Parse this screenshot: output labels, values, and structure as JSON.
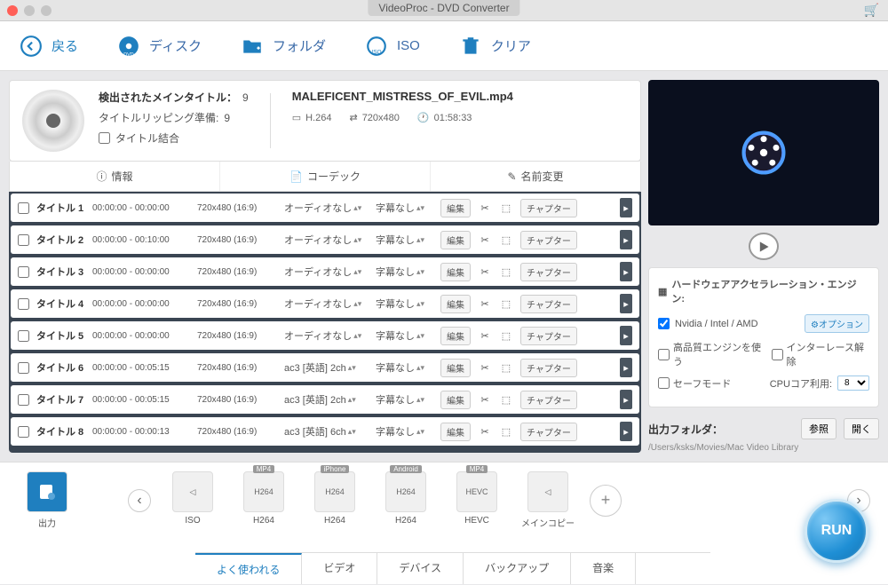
{
  "window": {
    "title": "VideoProc - DVD Converter"
  },
  "toolbar": {
    "back": "戻る",
    "disc": "ディスク",
    "folder": "フォルダ",
    "iso": "ISO",
    "clear": "クリア"
  },
  "info": {
    "detected_label": "検出されたメインタイトル：",
    "detected_count": "9",
    "prep_label": "タイトルリッピング準備:",
    "prep_count": "9",
    "merge_label": "タイトル結合",
    "filename": "MALEFICENT_MISTRESS_OF_EVIL.mp4",
    "codec": "H.264",
    "resolution": "720x480",
    "duration": "01:58:33"
  },
  "tabs": {
    "info": "情報",
    "codec": "コーデック",
    "rename": "名前変更"
  },
  "titles": [
    {
      "name": "タイトル 1",
      "time": "00:00:00 - 00:00:00",
      "res": "720x480 (16:9)",
      "audio": "オーディオなし",
      "sub": "字幕なし"
    },
    {
      "name": "タイトル 2",
      "time": "00:00:00 - 00:10:00",
      "res": "720x480 (16:9)",
      "audio": "オーディオなし",
      "sub": "字幕なし"
    },
    {
      "name": "タイトル 3",
      "time": "00:00:00 - 00:00:00",
      "res": "720x480 (16:9)",
      "audio": "オーディオなし",
      "sub": "字幕なし"
    },
    {
      "name": "タイトル 4",
      "time": "00:00:00 - 00:00:00",
      "res": "720x480 (16:9)",
      "audio": "オーディオなし",
      "sub": "字幕なし"
    },
    {
      "name": "タイトル 5",
      "time": "00:00:00 - 00:00:00",
      "res": "720x480 (16:9)",
      "audio": "オーディオなし",
      "sub": "字幕なし"
    },
    {
      "name": "タイトル 6",
      "time": "00:00:00 - 00:05:15",
      "res": "720x480 (16:9)",
      "audio": "ac3 [英語] 2ch",
      "sub": "字幕なし"
    },
    {
      "name": "タイトル 7",
      "time": "00:00:00 - 00:05:15",
      "res": "720x480 (16:9)",
      "audio": "ac3 [英語] 2ch",
      "sub": "字幕なし"
    },
    {
      "name": "タイトル 8",
      "time": "00:00:00 - 00:00:13",
      "res": "720x480 (16:9)",
      "audio": "ac3 [英語] 6ch",
      "sub": "字幕なし"
    }
  ],
  "row_buttons": {
    "edit": "編集",
    "chapter": "チャプター"
  },
  "hw": {
    "title": "ハードウェアアクセラレーション・エンジン:",
    "gpu": "Nvidia / Intel / AMD",
    "options": "オプション",
    "hq": "高品質エンジンを使う",
    "deint": "インターレース解除",
    "safe": "セーフモード",
    "cpu_label": "CPUコア利用:",
    "cpu_val": "8"
  },
  "output": {
    "label": "出力フォルダ：",
    "browse": "参照",
    "open": "開く",
    "path": "/Users/ksks/Movies/Mac Video Library"
  },
  "presets": {
    "output_label": "出力",
    "items": [
      {
        "top": "",
        "mid": "◁",
        "label": "ISO"
      },
      {
        "top": "MP4",
        "mid": "H264",
        "label": "H264"
      },
      {
        "top": "iPhone",
        "mid": "H264",
        "label": "H264"
      },
      {
        "top": "Android",
        "mid": "H264",
        "label": "H264"
      },
      {
        "top": "MP4",
        "mid": "HEVC",
        "label": "HEVC"
      },
      {
        "top": "",
        "mid": "◁",
        "label": "メインコピー"
      }
    ]
  },
  "bottom_tabs": {
    "popular": "よく使われる",
    "video": "ビデオ",
    "device": "デバイス",
    "backup": "バックアップ",
    "music": "音楽"
  },
  "run": "RUN"
}
